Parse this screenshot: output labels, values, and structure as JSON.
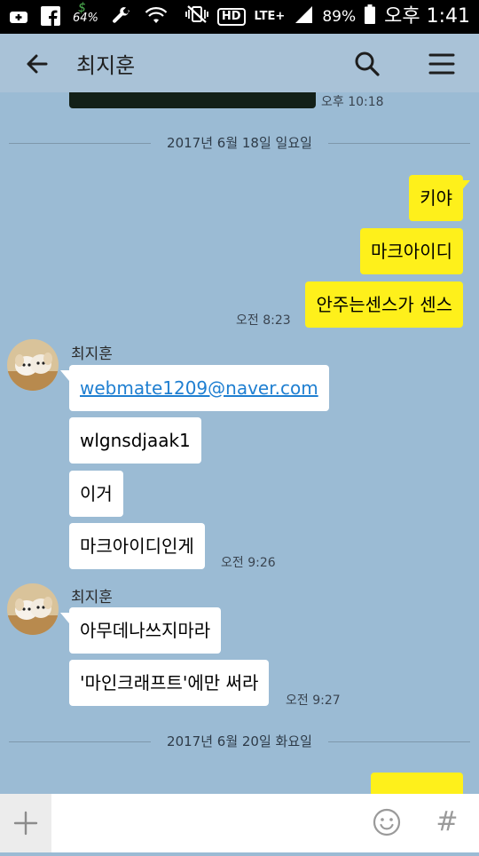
{
  "status_bar": {
    "wifi_percent": "64%",
    "hd_badge": "HD",
    "lte_label": "LTE+",
    "battery": "89%",
    "time": "오후 1:41"
  },
  "header": {
    "title": "최지훈"
  },
  "messages": {
    "m0_time": "오후 10:18",
    "date1": "2017년 6월 18일 일요일",
    "m1": "키야",
    "m2": "마크아이디",
    "m3": "안주는센스가 센스",
    "m3_time": "오전 8:23",
    "sender1": "최지훈",
    "m4": "webmate1209@naver.com",
    "m5": "wlgnsdjaak1",
    "m6": "이거",
    "m7": "마크아이디인게",
    "m7_time": "오전 9:26",
    "sender2": "최지훈",
    "m8": "아무데나쓰지마라",
    "m9": "'마인크래프트'에만 써라",
    "m9_time": "오전 9:27",
    "date2": "2017년 6월 20일 화요일"
  },
  "input": {
    "placeholder": "",
    "hash_label": "#"
  },
  "colors": {
    "chat_background": "#9bbbd4",
    "my_bubble": "#fef01b",
    "their_bubble": "#ffffff"
  }
}
